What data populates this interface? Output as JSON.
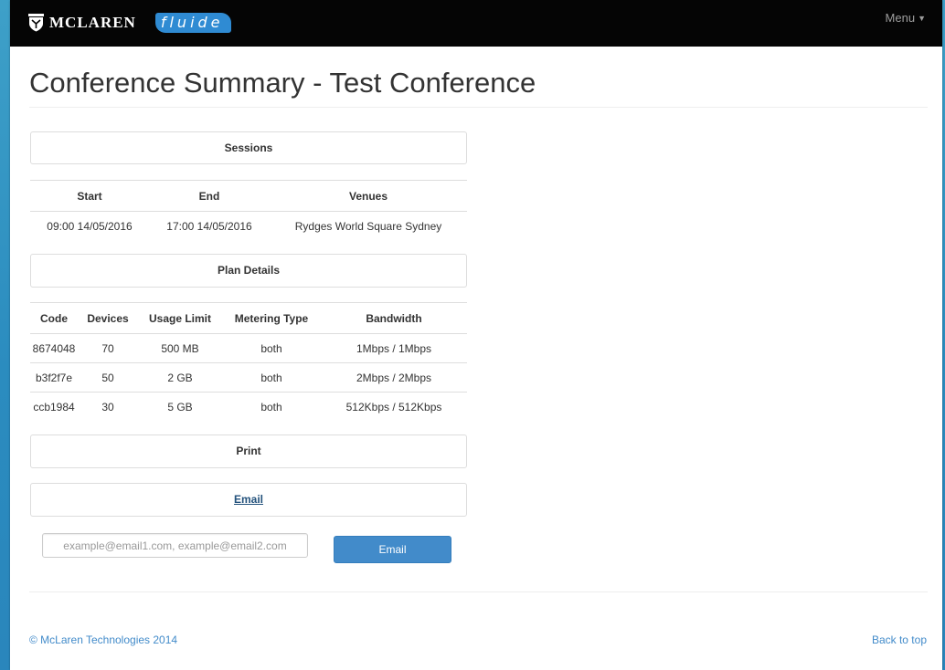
{
  "header": {
    "brand_name": "MCLAREN",
    "product_logo_text": "fluide",
    "menu_label": "Menu"
  },
  "page": {
    "title": "Conference Summary - Test Conference"
  },
  "sessions": {
    "heading": "Sessions",
    "columns": [
      "Start",
      "End",
      "Venues"
    ],
    "rows": [
      [
        "09:00 14/05/2016",
        "17:00 14/05/2016",
        "Rydges World Square Sydney"
      ]
    ]
  },
  "plan_details": {
    "heading": "Plan Details",
    "columns": [
      "Code",
      "Devices",
      "Usage Limit",
      "Metering Type",
      "Bandwidth"
    ],
    "rows": [
      [
        "8674048",
        "70",
        "500 MB",
        "both",
        "1Mbps / 1Mbps"
      ],
      [
        "b3f2f7e",
        "50",
        "2 GB",
        "both",
        "2Mbps / 2Mbps"
      ],
      [
        "ccb1984",
        "30",
        "5 GB",
        "both",
        "512Kbps / 512Kbps"
      ]
    ]
  },
  "actions": {
    "print_label": "Print",
    "email_link_label": "Email",
    "email_input_value": "",
    "email_input_placeholder": "example@email1.com, example@email2.com",
    "email_button_label": "Email"
  },
  "footer": {
    "copyright": "© McLaren Technologies 2014",
    "back_to_top": "Back to top"
  },
  "colors": {
    "navbar": "#050505",
    "primary_button": "#428bca",
    "link": "#428bca",
    "fluide_logo": "#2f8bd3",
    "desktop_background": "#2b8cbf"
  }
}
